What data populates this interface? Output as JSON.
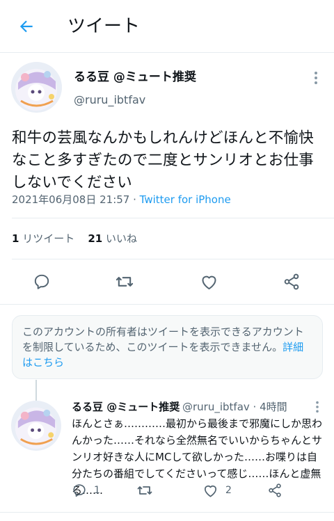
{
  "header": {
    "title": "ツイート"
  },
  "tweet": {
    "author_name": "るる豆 @ミュート推奨",
    "author_handle": "@ruru_ibtfav",
    "text": "和牛の芸風なんかもしれんけどほんと不愉快なこと多すぎたので二度とサンリオとお仕事しないでください",
    "timestamp": "2021年06月08日 21:57",
    "separator": " · ",
    "source": "Twitter for iPhone",
    "retweet_count": "1",
    "retweet_label": "リツイート",
    "like_count": "21",
    "like_label": "いいね"
  },
  "notice": {
    "text": "このアカウントの所有者はツイートを表示できるアカウントを制限しているため、このツイートを表示できません。",
    "link": "詳細はこちら"
  },
  "reply": {
    "author_name": "るる豆 @ミュート推奨",
    "meta": "@ruru_ibtfav · 4時間",
    "text": "ほんとさぁ…………最初から最後まで邪魔にしか思わんかった……それなら全然無名でいいからちゃんとサンリオ好きな人にMCして欲しかった……お喋りは自分たちの番組でしてくださいって感じ……ほんと虚無る……",
    "reply_count": "1",
    "like_count": "2"
  },
  "icons": {
    "back": "arrow-left-icon",
    "more": "vertical-ellipsis-icon",
    "reply": "speech-bubble-icon",
    "retweet": "retweet-icon",
    "like": "heart-icon",
    "share": "share-icon"
  },
  "colors": {
    "accent": "#1d9bf0",
    "text": "#0f1419",
    "secondary": "#536471",
    "border": "#e6ecf0"
  }
}
